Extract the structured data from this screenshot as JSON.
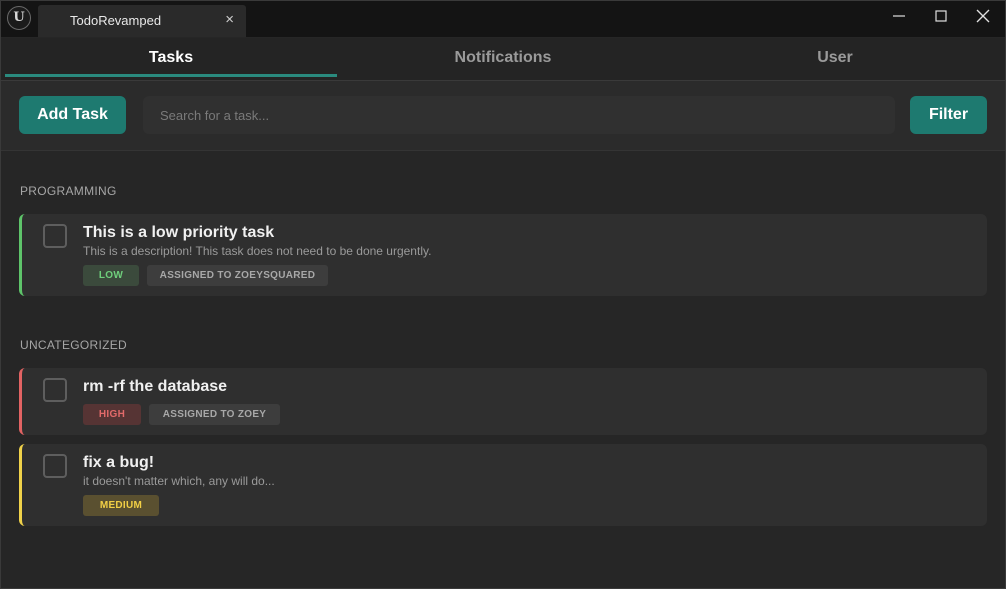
{
  "titlebar": {
    "logo": "U",
    "tab_label": "TodoRevamped",
    "close_glyph": "×"
  },
  "nav": {
    "tabs": [
      {
        "label": "Tasks",
        "active": true
      },
      {
        "label": "Notifications",
        "active": false
      },
      {
        "label": "User",
        "active": false
      }
    ]
  },
  "toolbar": {
    "add_label": "Add Task",
    "search_placeholder": "Search for a task...",
    "search_value": "",
    "filter_label": "Filter"
  },
  "sections": [
    {
      "title": "PROGRAMMING",
      "tasks": [
        {
          "title": "This is a low priority task",
          "description": "This is a description! This task does not need to be done urgently.",
          "priority": "LOW",
          "assignee": "ASSIGNED TO ZOEYSQUARED",
          "done": false
        }
      ]
    },
    {
      "title": "UNCATEGORIZED",
      "tasks": [
        {
          "title": "rm -rf the database",
          "description": "",
          "priority": "HIGH",
          "assignee": "ASSIGNED TO ZOEY",
          "done": false
        },
        {
          "title": "fix a bug!",
          "description": "it doesn't matter which, any will do...",
          "priority": "MEDIUM",
          "assignee": "",
          "done": false
        }
      ]
    }
  ],
  "colors": {
    "accent": "#1e7a70",
    "priority_low": "#5ec46a",
    "priority_high": "#e26363",
    "priority_medium": "#f0d24a"
  },
  "icons": {
    "minimize": "minimize-icon",
    "maximize": "maximize-icon",
    "close": "close-icon",
    "logo": "unreal-logo-icon"
  }
}
